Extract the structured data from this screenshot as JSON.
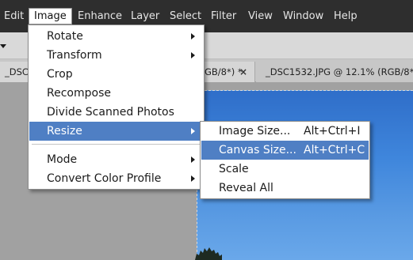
{
  "menubar": {
    "items": [
      "Edit",
      "Image",
      "Enhance",
      "Layer",
      "Select",
      "Filter",
      "View",
      "Window",
      "Help"
    ],
    "open_menu": "Image"
  },
  "tabs": [
    {
      "label_start": "_DSC",
      "label_end": "GB/8*) *",
      "close": "×",
      "active": true
    },
    {
      "label": "_DSC1532.JPG @ 12.1% (RGB/8*)",
      "active": false
    }
  ],
  "image_menu": {
    "items": [
      {
        "label": "Rotate",
        "submenu": true
      },
      {
        "label": "Transform",
        "submenu": true
      },
      {
        "label": "Crop",
        "submenu": false
      },
      {
        "label": "Recompose",
        "submenu": false
      },
      {
        "label": "Divide Scanned Photos",
        "submenu": false
      },
      {
        "label": "Resize",
        "submenu": true,
        "highlighted": true
      },
      {
        "label": "Mode",
        "submenu": true
      },
      {
        "label": "Convert Color Profile",
        "submenu": true
      }
    ]
  },
  "resize_submenu": {
    "items": [
      {
        "label": "Image Size...",
        "shortcut": "Alt+Ctrl+I"
      },
      {
        "label": "Canvas Size...",
        "shortcut": "Alt+Ctrl+C",
        "highlighted": true
      },
      {
        "label": "Scale",
        "shortcut": ""
      },
      {
        "label": "Reveal All",
        "shortcut": ""
      }
    ]
  },
  "colors": {
    "menubar_bg": "#2e2e2e",
    "highlight": "#4f7fc4",
    "sky": "#3f86dc"
  },
  "icons": {
    "submenu_arrow": "chevron-right-icon",
    "options_dropdown": "caret-down-icon",
    "tab_close": "close-icon"
  }
}
